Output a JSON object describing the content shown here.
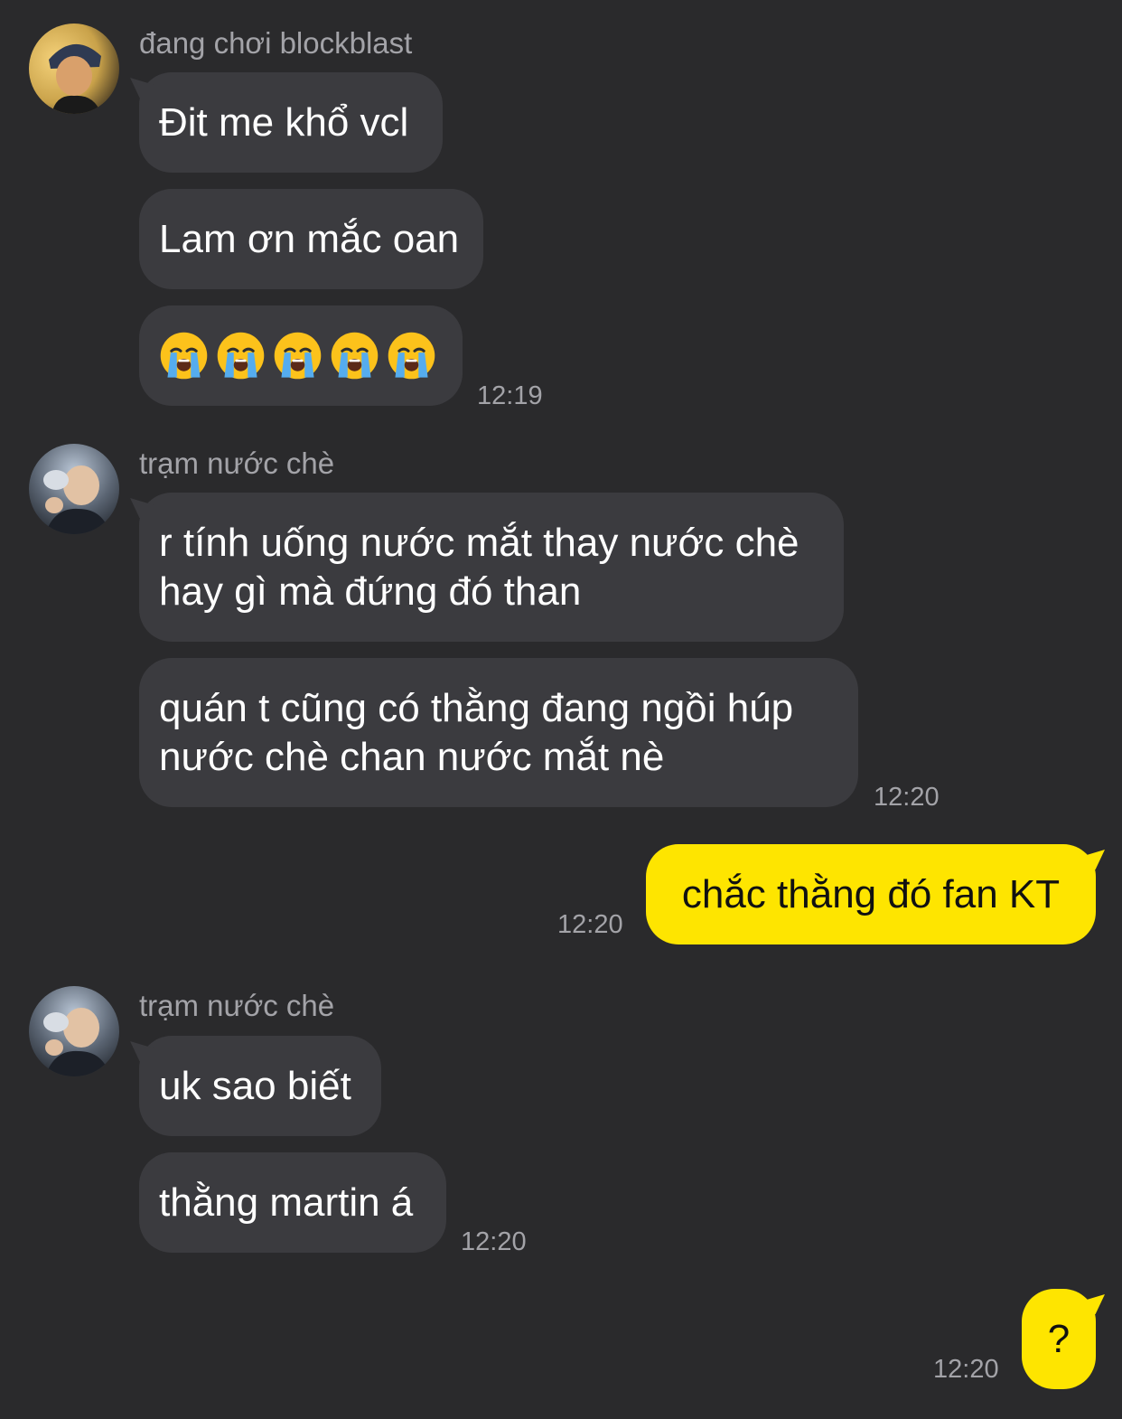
{
  "groups": [
    {
      "sender": "đang chơi blockblast",
      "messages": [
        "Đit me khổ vcl",
        "Lam ơn mắc oan",
        "😭😭😭😭😭"
      ],
      "time": "12:19"
    },
    {
      "sender": "trạm nước chè",
      "messages": [
        "r tính uống nước mắt thay nước chè\nhay gì mà đứng đó than",
        "quán t cũng có thằng đang ngồi húp\nnước chè chan nước mắt nè"
      ],
      "time": "12:20"
    },
    {
      "sender": "trạm nước chè",
      "messages": [
        "uk sao biết",
        "thằng martin á"
      ],
      "time": "12:20"
    }
  ],
  "outgoing": [
    {
      "text": "chắc thằng đó fan KT",
      "time": "12:20"
    },
    {
      "text": "?",
      "time": "12:20"
    }
  ],
  "emoji": {
    "icon": "loudly-crying-face-icon",
    "count": 5
  },
  "colors": {
    "background": "#2a2a2c",
    "incoming_bubble": "#3b3b3f",
    "outgoing_bubble": "#fee500",
    "meta_text": "#a3a3a8"
  }
}
